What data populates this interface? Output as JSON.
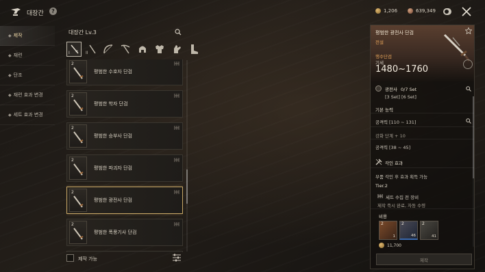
{
  "header": {
    "title": "대장간",
    "help_label": "?",
    "currency_1": "1,206",
    "currency_2": "639,349"
  },
  "sidebar": {
    "items": [
      {
        "label": "제작",
        "active": true
      },
      {
        "label": "재련",
        "active": false
      },
      {
        "label": "단조",
        "active": false
      },
      {
        "label": "재련 효과 변경",
        "active": false
      },
      {
        "label": "세트 효과 변경",
        "active": false
      }
    ]
  },
  "list": {
    "title": "대장간 Lv.3",
    "tabs": [
      "sword-icon",
      "dagger-icon",
      "bow-icon",
      "crossbow-icon",
      "helmet-icon",
      "armor-icon",
      "gloves-icon",
      "boots-icon"
    ],
    "tab_marks": [
      "I",
      "II"
    ],
    "items": [
      {
        "tier": "2",
        "name": "평범한 수호자 단검"
      },
      {
        "tier": "2",
        "name": "평범한 학자 단검"
      },
      {
        "tier": "2",
        "name": "평범한 승부사 단검"
      },
      {
        "tier": "2",
        "name": "평범한 파괴자 단검"
      },
      {
        "tier": "2",
        "name": "평범한 광전사 단검",
        "selected": true
      },
      {
        "tier": "2",
        "name": "평범한 폭풍기사 단검"
      }
    ],
    "footer_checkbox": "제작 가능"
  },
  "detail": {
    "name": "평범한 광전사 단검",
    "grade": "전설",
    "quality": "행수단검",
    "energy_label": "기세",
    "energy": "1480~1760",
    "set_name": "광전사",
    "set_count": "0/7 Set",
    "set_bonus": "[3 Set]  [6 Set]",
    "basic_label": "기본 능력",
    "stat_1": "공격력 [110 ~ 131]",
    "upgrade": "강화 단계 + 10",
    "stat_2": "공격력 [38 ~ 45]",
    "engrave_label": "각인 효과",
    "engrave_desc": "부품 각인 후 효과 획득 가능",
    "tier_label": "Tier.2",
    "set_equip": "세트 수집 전 장비",
    "set_note": "제작 즉시 완료, 자동 수령",
    "cost_label": "비용",
    "materials": [
      {
        "tier": "2",
        "count": "1"
      },
      {
        "tier": "2",
        "count": "46"
      },
      {
        "tier": "2",
        "count": "41"
      }
    ],
    "cost_amount": "11,700",
    "craft_button": "제작"
  },
  "colors": {
    "accent_gold": "#c8a766",
    "grade_orange": "#e6a45a"
  }
}
